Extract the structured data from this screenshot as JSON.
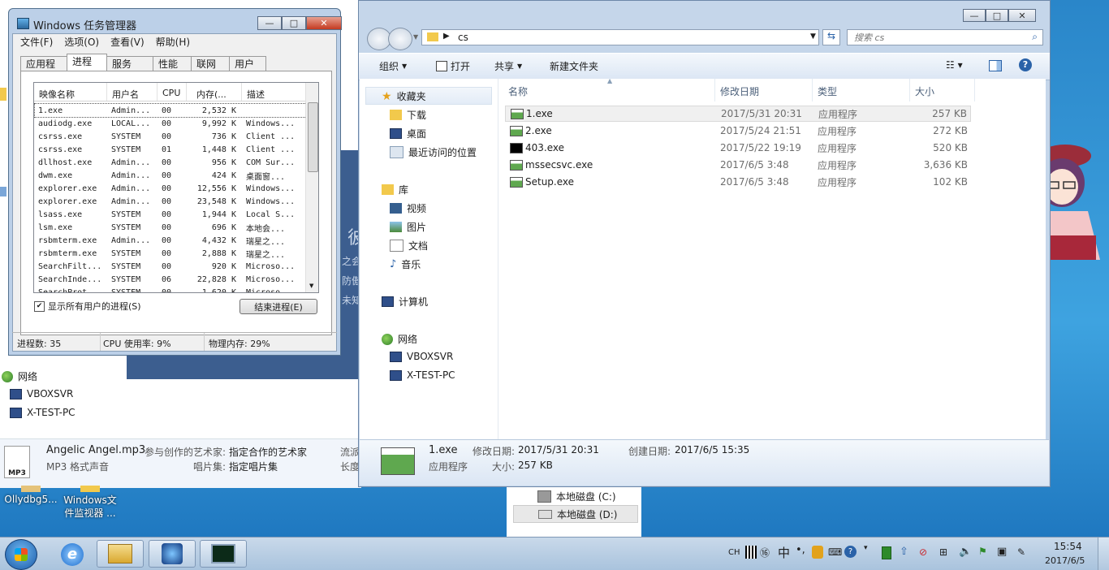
{
  "desktop": {
    "icons": [
      {
        "label": "Ollydbg5...",
        "label2": ""
      },
      {
        "label": "Windows文",
        "label2": "件监视器 ..."
      }
    ]
  },
  "bg_explorer": {
    "nav": [
      {
        "label": "网络"
      },
      {
        "label": "VBOXSVR"
      },
      {
        "label": "X-TEST-PC"
      }
    ],
    "blue_text": [
      "之会",
      "防傲",
      "未知"
    ],
    "blue_big_char": "彼",
    "details": {
      "filename": "Angelic Angel.mp3",
      "contrib_label": "参与创作的艺术家:",
      "contrib_value": "指定合作的艺术家",
      "extra_label": "流派",
      "filetype": "MP3 格式声音",
      "album_label": "唱片集:",
      "album_value": "指定唱片集",
      "extra_label2": "长度",
      "icon_text": "MP3"
    },
    "drives": [
      {
        "label": "本地磁盘 (C:)"
      },
      {
        "label": "本地磁盘 (D:)"
      }
    ]
  },
  "task_manager": {
    "title": "Windows 任务管理器",
    "menu": [
      "文件(F)",
      "选项(O)",
      "查看(V)",
      "帮助(H)"
    ],
    "tabs": [
      "应用程序",
      "进程",
      "服务",
      "性能",
      "联网",
      "用户"
    ],
    "active_tab": "进程",
    "columns": [
      "映像名称",
      "用户名",
      "CPU",
      "内存(...",
      "描述"
    ],
    "rows": [
      [
        "1.exe",
        "Admin...",
        "00",
        "2,532 K",
        ""
      ],
      [
        "audiodg.exe",
        "LOCAL...",
        "00",
        "9,992 K",
        "Windows..."
      ],
      [
        "csrss.exe",
        "SYSTEM",
        "00",
        "736 K",
        "Client ..."
      ],
      [
        "csrss.exe",
        "SYSTEM",
        "01",
        "1,448 K",
        "Client ..."
      ],
      [
        "dllhost.exe",
        "Admin...",
        "00",
        "956 K",
        "COM Sur..."
      ],
      [
        "dwm.exe",
        "Admin...",
        "00",
        "424 K",
        "桌面窗..."
      ],
      [
        "explorer.exe",
        "Admin...",
        "00",
        "12,556 K",
        "Windows..."
      ],
      [
        "explorer.exe",
        "Admin...",
        "00",
        "23,548 K",
        "Windows..."
      ],
      [
        "lsass.exe",
        "SYSTEM",
        "00",
        "1,944 K",
        "Local S..."
      ],
      [
        "lsm.exe",
        "SYSTEM",
        "00",
        "696 K",
        "本地会..."
      ],
      [
        "rsbmterm.exe",
        "Admin...",
        "00",
        "4,432 K",
        "瑞星之..."
      ],
      [
        "rsbmterm.exe",
        "SYSTEM",
        "00",
        "2,888 K",
        "瑞星之..."
      ],
      [
        "SearchFilt...",
        "SYSTEM",
        "00",
        "920 K",
        "Microso..."
      ],
      [
        "SearchInde...",
        "SYSTEM",
        "06",
        "22,828 K",
        "Microso..."
      ],
      [
        "SearchProt...",
        "SYSTEM",
        "00",
        "1,620 K",
        "Microso..."
      ]
    ],
    "show_all_label": "显示所有用户的进程(S)",
    "end_process_label": "结束进程(E)",
    "status": {
      "processes": "进程数: 35",
      "cpu": "CPU 使用率: 9%",
      "memory": "物理内存: 29%"
    }
  },
  "explorer": {
    "path": "cs",
    "search_placeholder": "搜索 cs",
    "toolbar": {
      "organize": "组织",
      "open": "打开",
      "share": "共享",
      "new_folder": "新建文件夹"
    },
    "nav": {
      "favorites": "收藏夹",
      "fav_items": [
        "下载",
        "桌面",
        "最近访问的位置"
      ],
      "libraries": "库",
      "lib_items": [
        "视频",
        "图片",
        "文档",
        "音乐"
      ],
      "computer": "计算机",
      "network": "网络",
      "net_items": [
        "VBOXSVR",
        "X-TEST-PC"
      ]
    },
    "columns": [
      "名称",
      "修改日期",
      "类型",
      "大小"
    ],
    "files": [
      {
        "name": "1.exe",
        "date": "2017/5/31 20:31",
        "type": "应用程序",
        "size": "257 KB"
      },
      {
        "name": "2.exe",
        "date": "2017/5/24 21:51",
        "type": "应用程序",
        "size": "272 KB"
      },
      {
        "name": "403.exe",
        "date": "2017/5/22 19:19",
        "type": "应用程序",
        "size": "520 KB"
      },
      {
        "name": "mssecsvc.exe",
        "date": "2017/6/5 3:48",
        "type": "应用程序",
        "size": "3,636 KB"
      },
      {
        "name": "Setup.exe",
        "date": "2017/6/5 3:48",
        "type": "应用程序",
        "size": "102 KB"
      }
    ],
    "details": {
      "filename": "1.exe",
      "filetype": "应用程序",
      "modified_label": "修改日期:",
      "modified_value": "2017/5/31 20:31",
      "created_label": "创建日期:",
      "created_value": "2017/6/5 15:35",
      "size_label": "大小:",
      "size_value": "257 KB"
    }
  },
  "taskbar": {
    "tray_lang": "CH",
    "tray_ime": "中",
    "time": "15:54",
    "date": "2017/6/5"
  },
  "colors": {
    "selection": "#cce8ff",
    "window_frame": "#bcd0e8",
    "desktop": "#2a86c9"
  }
}
